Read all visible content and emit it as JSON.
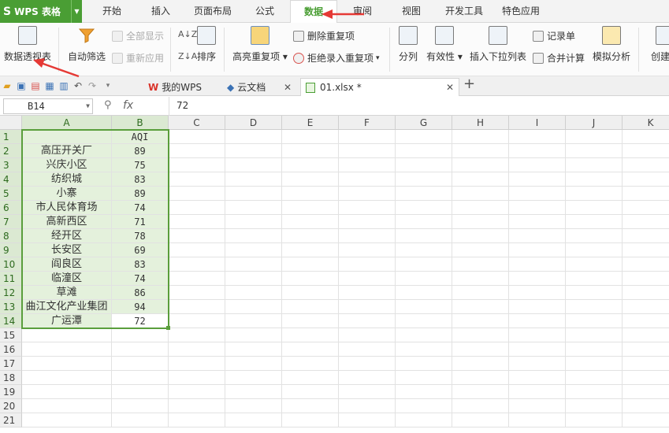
{
  "app": {
    "logo": "S",
    "name": "WPS 表格"
  },
  "menu_tabs": [
    "开始",
    "插入",
    "页面布局",
    "公式",
    "数据",
    "审阅",
    "视图",
    "开发工具",
    "特色应用"
  ],
  "ribbon": {
    "pivot": "数据透视表",
    "autofilter": "自动筛选",
    "show_all": "全部显示",
    "reapply": "重新应用",
    "sort": "排序",
    "highlight_dup": "高亮重复项",
    "remove_dup": "删除重复项",
    "reject_dup": "拒绝录入重复项",
    "split": "分列",
    "validity": "有效性",
    "insert_dropdown": "插入下拉列表",
    "record_form": "记录单",
    "consolidate": "合并计算",
    "simulate": "模拟分析",
    "create_group": "创建组"
  },
  "doc_tabs": [
    {
      "label": "我的WPS"
    },
    {
      "label": "云文档"
    },
    {
      "label": "01.xlsx *"
    }
  ],
  "formula_bar": {
    "cell_ref": "B14",
    "fx": "fx",
    "value": "72"
  },
  "columns": [
    "A",
    "B",
    "C",
    "D",
    "E",
    "F",
    "G",
    "H",
    "I",
    "J",
    "K"
  ],
  "rows": [
    "1",
    "2",
    "3",
    "4",
    "5",
    "6",
    "7",
    "8",
    "9",
    "10",
    "11",
    "12",
    "13",
    "14",
    "15",
    "16",
    "17",
    "18",
    "19",
    "20",
    "21"
  ],
  "sheet": {
    "header": {
      "a": "",
      "b": "AQI"
    },
    "data": [
      {
        "a": "高压开关厂",
        "b": "89"
      },
      {
        "a": "兴庆小区",
        "b": "75"
      },
      {
        "a": "纺织城",
        "b": "83"
      },
      {
        "a": "小寨",
        "b": "89"
      },
      {
        "a": "市人民体育场",
        "b": "74"
      },
      {
        "a": "高新西区",
        "b": "71"
      },
      {
        "a": "经开区",
        "b": "78"
      },
      {
        "a": "长安区",
        "b": "69"
      },
      {
        "a": "阎良区",
        "b": "83"
      },
      {
        "a": "临潼区",
        "b": "74"
      },
      {
        "a": "草滩",
        "b": "86"
      },
      {
        "a": "曲江文化产业集团",
        "b": "94"
      },
      {
        "a": "广运潭",
        "b": "72"
      }
    ]
  },
  "colors": {
    "brand": "#4a9e34",
    "selection": "#5a9e3c",
    "arrow": "#e53935"
  }
}
